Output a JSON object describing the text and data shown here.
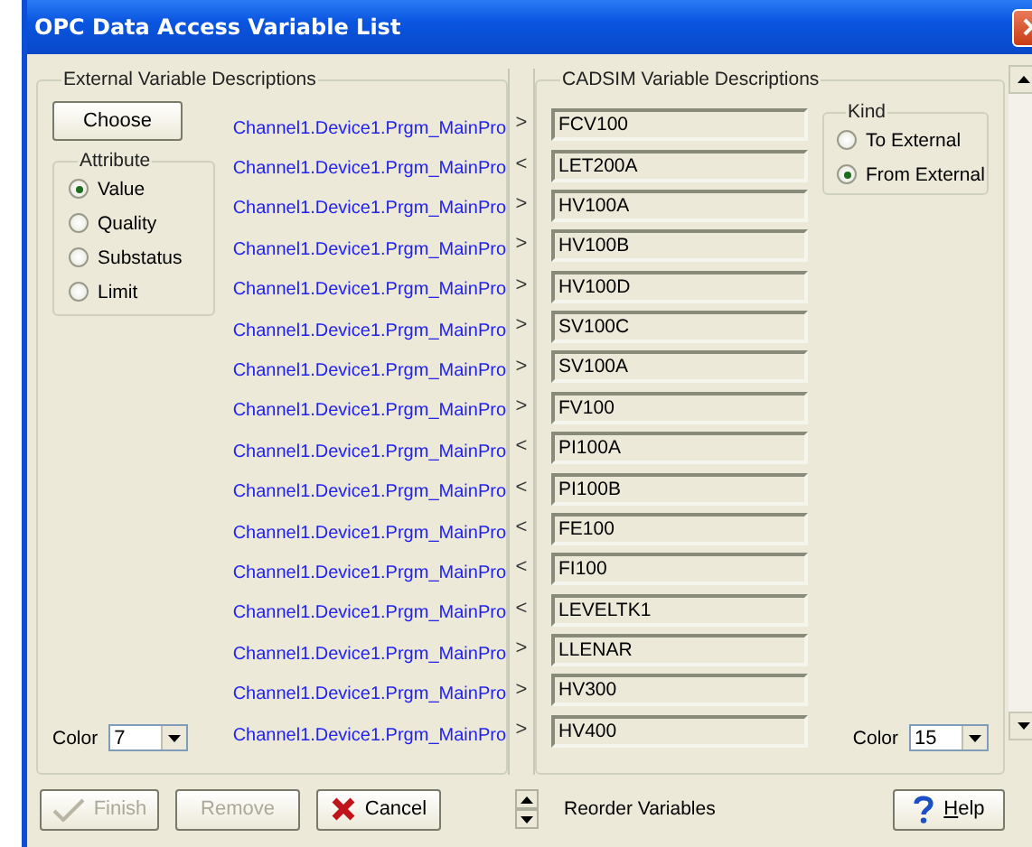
{
  "window": {
    "title": "OPC Data Access Variable List"
  },
  "external": {
    "title": "External Variable Descriptions",
    "choose_button": "Choose",
    "attribute": {
      "title": "Attribute",
      "options": [
        {
          "label": "Value",
          "selected": true
        },
        {
          "label": "Quality",
          "selected": false
        },
        {
          "label": "Substatus",
          "selected": false
        },
        {
          "label": "Limit",
          "selected": false
        }
      ]
    },
    "color_label": "Color",
    "color_value": "7"
  },
  "rows": [
    {
      "external": "Channel1.Device1.Prgm_MainPro",
      "direction": ">",
      "cadsim": "FCV100"
    },
    {
      "external": "Channel1.Device1.Prgm_MainPro",
      "direction": "<",
      "cadsim": "LET200A"
    },
    {
      "external": "Channel1.Device1.Prgm_MainPro",
      "direction": ">",
      "cadsim": "HV100A"
    },
    {
      "external": "Channel1.Device1.Prgm_MainPro",
      "direction": ">",
      "cadsim": "HV100B"
    },
    {
      "external": "Channel1.Device1.Prgm_MainPro",
      "direction": ">",
      "cadsim": "HV100D"
    },
    {
      "external": "Channel1.Device1.Prgm_MainPro",
      "direction": ">",
      "cadsim": "SV100C"
    },
    {
      "external": "Channel1.Device1.Prgm_MainPro",
      "direction": ">",
      "cadsim": "SV100A"
    },
    {
      "external": "Channel1.Device1.Prgm_MainPro",
      "direction": ">",
      "cadsim": "FV100"
    },
    {
      "external": "Channel1.Device1.Prgm_MainPro",
      "direction": "<",
      "cadsim": "PI100A"
    },
    {
      "external": "Channel1.Device1.Prgm_MainPro",
      "direction": "<",
      "cadsim": "PI100B"
    },
    {
      "external": "Channel1.Device1.Prgm_MainPro",
      "direction": "<",
      "cadsim": "FE100"
    },
    {
      "external": "Channel1.Device1.Prgm_MainPro",
      "direction": "<",
      "cadsim": "FI100"
    },
    {
      "external": "Channel1.Device1.Prgm_MainPro",
      "direction": "<",
      "cadsim": "LEVELTK1"
    },
    {
      "external": "Channel1.Device1.Prgm_MainPro",
      "direction": ">",
      "cadsim": "LLENAR"
    },
    {
      "external": "Channel1.Device1.Prgm_MainPro",
      "direction": ">",
      "cadsim": "HV300"
    },
    {
      "external": "Channel1.Device1.Prgm_MainPro",
      "direction": ">",
      "cadsim": "HV400"
    }
  ],
  "cadsim": {
    "title": "CADSIM Variable Descriptions",
    "kind": {
      "title": "Kind",
      "options": [
        {
          "label": "To External",
          "selected": false
        },
        {
          "label": "From External",
          "selected": true
        }
      ]
    },
    "color_label": "Color",
    "color_value": "15"
  },
  "buttons": [
    {
      "kind": "finish",
      "label": "Finish",
      "disabled": true
    },
    {
      "kind": "remove",
      "label": "Remove",
      "disabled": true
    },
    {
      "kind": "cancel",
      "label": "Cancel",
      "disabled": false
    }
  ],
  "reorder_label": "Reorder Variables",
  "help_button": {
    "label": "Help"
  }
}
